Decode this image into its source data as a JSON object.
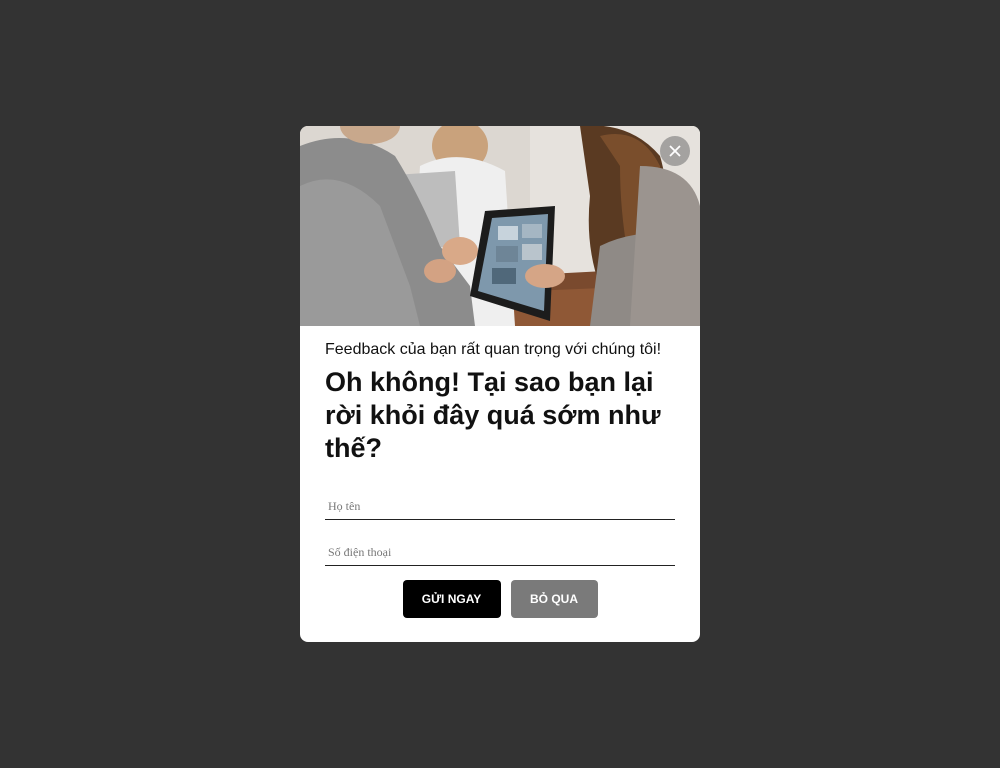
{
  "modal": {
    "subtitle": "Feedback của bạn rất quan trọng với chúng tôi!",
    "headline": "Oh không! Tại sao bạn lại rời khỏi đây quá sớm như thế?",
    "hero_image": "people-with-tablet-photo",
    "close_icon": "close-icon"
  },
  "form": {
    "name_placeholder": "Họ tên",
    "name_value": "",
    "phone_placeholder": "Số điện thoại",
    "phone_value": ""
  },
  "actions": {
    "submit_label": "GỬI NGAY",
    "skip_label": "BỎ QUA"
  },
  "colors": {
    "backdrop": "#333333",
    "primary_button": "#000000",
    "secondary_button": "#7a7a7a"
  }
}
